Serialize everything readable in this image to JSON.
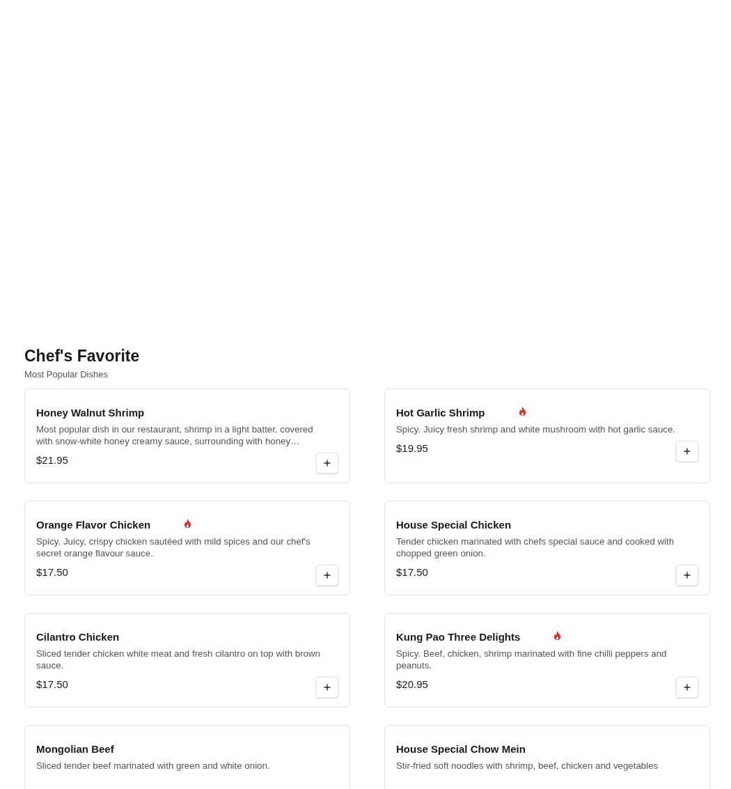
{
  "section": {
    "title": "Chef's Favorite",
    "subtitle": "Most Popular Dishes"
  },
  "dishes": [
    {
      "name": "Honey Walnut Shrimp",
      "spicy": false,
      "description": "Most popular dish in our restaurant, shrimp in a light batter, covered with snow-white honey creamy sauce, surrounding with honey…",
      "price": "$21.95"
    },
    {
      "name": "Hot Garlic Shrimp",
      "spicy": true,
      "description": "Spicy. Juicy fresh shrimp and white mushroom with hot garlic sauce.",
      "price": "$19.95"
    },
    {
      "name": "Orange Flavor Chicken",
      "spicy": true,
      "description": "Spicy. Juicy, crispy chicken sautéed with mild spices and our chef's secret orange flavour sauce.",
      "price": "$17.50"
    },
    {
      "name": "House Special Chicken",
      "spicy": false,
      "description": "Tender chicken marinated with chefs special sauce and cooked with chopped green onion.",
      "price": "$17.50"
    },
    {
      "name": "Cilantro Chicken",
      "spicy": false,
      "description": "Sliced tender chicken white meat and fresh cilantro on top with brown sauce.",
      "price": "$17.50"
    },
    {
      "name": "Kung Pao Three Delights",
      "spicy": true,
      "description": "Spicy. Beef, chicken, shrimp marinated with fine chilli peppers and peanuts.",
      "price": "$20.95"
    },
    {
      "name": "Mongolian Beef",
      "spicy": false,
      "description": "Sliced tender beef marinated with green and white onion."
    },
    {
      "name": "House Special Chow Mein",
      "spicy": false,
      "description": "Stir-fried soft noodles with shrimp, beef, chicken and vegetables"
    }
  ]
}
